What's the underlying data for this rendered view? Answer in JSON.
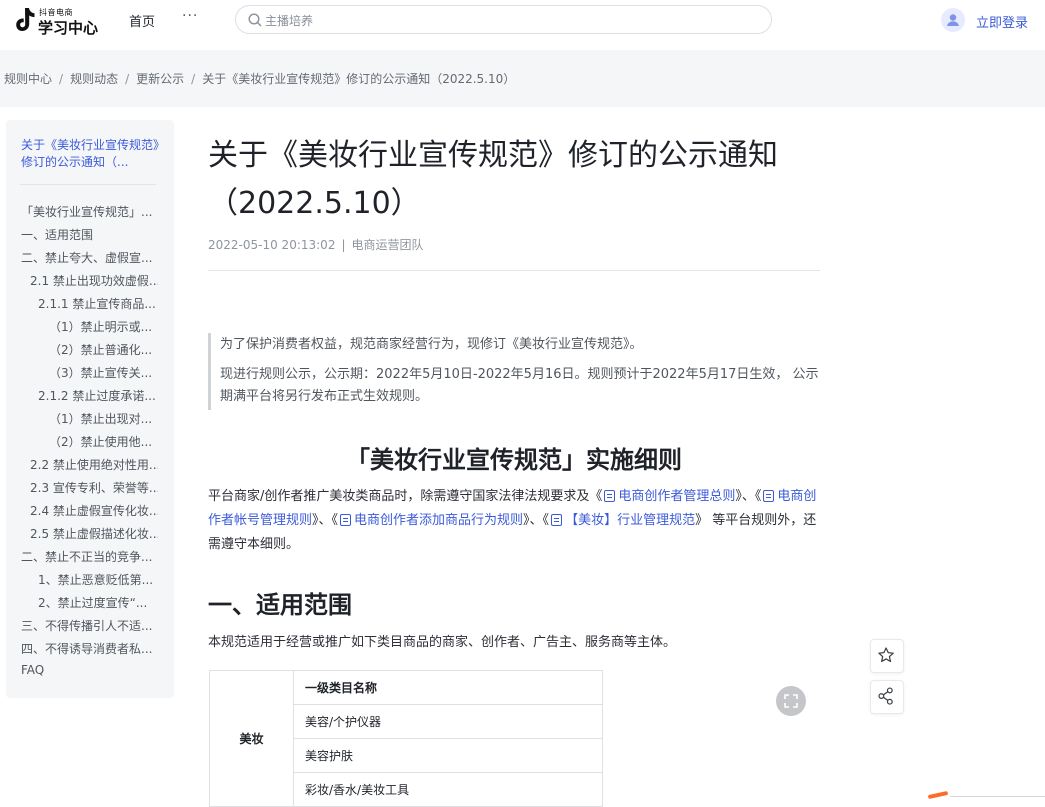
{
  "header": {
    "logo_small": "抖音电商",
    "logo_text": "学习中心",
    "nav_home": "首页",
    "nav_more": "···",
    "search_placeholder": "主播培养",
    "login": "立即登录"
  },
  "breadcrumb": [
    "规则中心",
    "规则动态",
    "更新公示",
    "关于《美妆行业宣传规范》修订的公示通知（2022.5.10）"
  ],
  "sidebar": {
    "current": "关于《美妆行业宣传规范》修订的公示通知（...",
    "items": [
      "「美妆行业宣传规范」...",
      "一、适用范围",
      "二、禁止夸大、虚假宣...",
      "2.1 禁止出现功效虚假...",
      "2.1.1 禁止宣传商品...",
      "（1）禁止明示或...",
      "（2）禁止普通化...",
      "（3）禁止宣传关...",
      "2.1.2 禁止过度承诺...",
      "（1）禁止出现对...",
      "（2）禁止使用他...",
      "2.2 禁止使用绝对性用...",
      "2.3 宣传专利、荣誉等...",
      "2.4 禁止虚假宣传化妆...",
      "2.5 禁止虚假描述化妆...",
      "二、禁止不正当的竞争...",
      "1、禁止恶意贬低第...",
      "2、禁止过度宣传“...",
      "三、不得传播引人不适...",
      "四、不得诱导消费者私...",
      "FAQ"
    ]
  },
  "article": {
    "title": "关于《美妆行业宣传规范》修订的公示通知（2022.5.10）",
    "date": "2022-05-10 20:13:02",
    "author": "电商运营团队",
    "quote1": "为了保护消费者权益，规范商家经营行为，现修订《美妆行业宣传规范》。",
    "quote2": "现进行规则公示，公示期：2022年5月10日-2022年5月16日。规则预计于2022年5月17日生效， 公示期满平台将另行发布正式生效规则。",
    "section_title": "「美妆行业宣传规范」实施细则",
    "intro_before": "平台商家/创作者推广美妆类商品时，除需遵守国家法律法规要求及《",
    "link1": "电商创作者管理总则",
    "sep1": "》、《",
    "link2": "电商创作者帐号管理规则",
    "sep2": "》、《",
    "link3": "电商创作者添加商品行为规则",
    "sep3": "》、《",
    "link4": "【美妆】行业管理规范",
    "intro_after": "》 等平台规则外，还需遵守本细则。",
    "h1": "一、适用范围",
    "scope": "本规范适用于经营或推广如下类目商品的商家、创作者、广告主、服务商等主体。"
  },
  "table": {
    "category": "美妆",
    "header": "一级类目名称",
    "rows": [
      "美容/个护仪器",
      "美容护肤",
      "彩妆/香水/美妆工具"
    ]
  },
  "icons": [
    "douyin-logo-icon",
    "search-icon",
    "user-icon",
    "star-icon",
    "share-icon",
    "expand-icon",
    "doc-link-icon"
  ],
  "colors": {
    "link": "#3c5bd9",
    "accent": "#ff6a2a"
  }
}
